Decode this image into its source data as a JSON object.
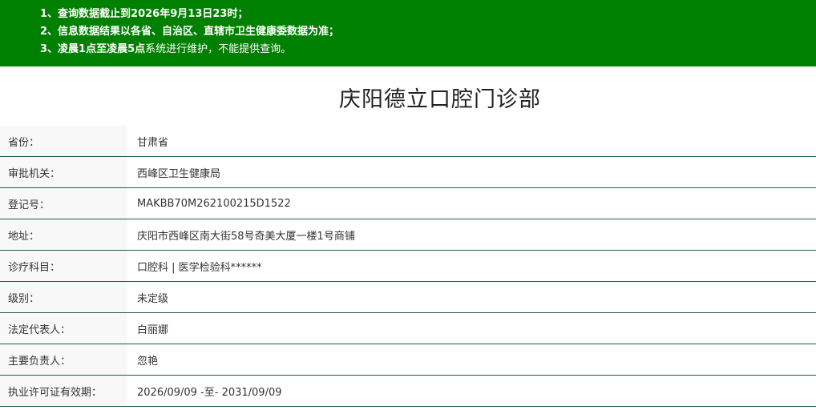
{
  "notice": {
    "line1": "1、查询数据截止到2026年9月13日23时；",
    "line2": "2、信息数据结果以各省、自治区、直辖市卫生健康委数据为准；",
    "line3_bold": "3、凌晨1点至凌晨5点",
    "line3_rest": "系统进行维护，不能提供查询。"
  },
  "title": "庆阳德立口腔门诊部",
  "rows": [
    {
      "label": "省份：",
      "value": "甘肃省"
    },
    {
      "label": "审批机关：",
      "value": "西峰区卫生健康局"
    },
    {
      "label": "登记号：",
      "value": "MAKBB70M262100215D1522"
    },
    {
      "label": "地址：",
      "value": "庆阳市西峰区南大街58号奇美大厦一楼1号商铺"
    },
    {
      "label": "诊疗科目：",
      "value": "口腔科 | 医学检验科******"
    },
    {
      "label": "级别：",
      "value": "未定级"
    },
    {
      "label": "法定代表人：",
      "value": "白丽娜"
    },
    {
      "label": "主要负责人：",
      "value": "忽艳"
    },
    {
      "label": "执业许可证有效期：",
      "value": "2026/09/09 -至- 2031/09/09"
    }
  ]
}
